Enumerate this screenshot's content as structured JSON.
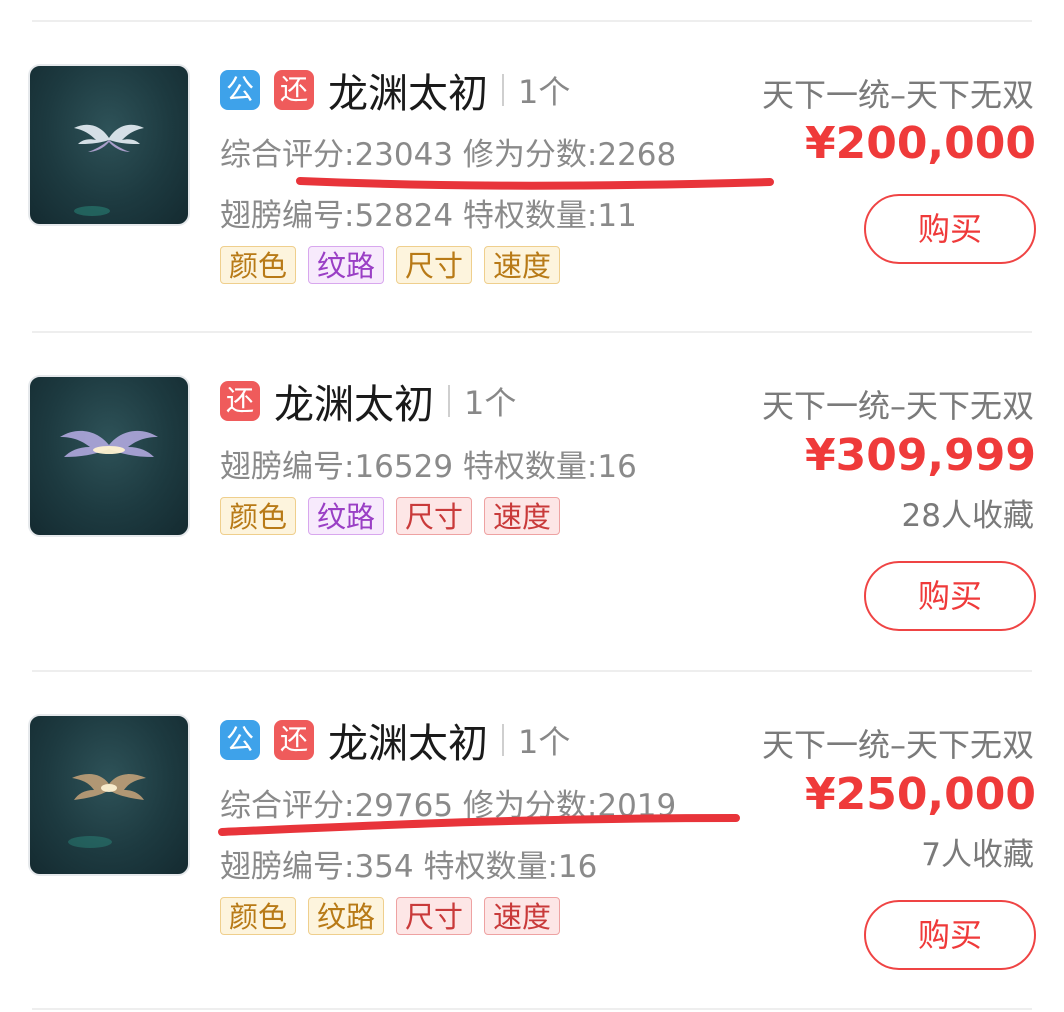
{
  "listings": [
    {
      "badges": [
        "公",
        "还"
      ],
      "name": "龙渊太初",
      "count": "1个",
      "score_line": "综合评分:23043 修为分数:2268",
      "wing_line": "翅膀编号:52824 特权数量:11",
      "tags": [
        "颜色",
        "纹路",
        "尺寸",
        "速度"
      ],
      "server": "天下一统–天下无双",
      "price": "¥200,000",
      "buy_label": "购买"
    },
    {
      "badges": [
        "还"
      ],
      "name": "龙渊太初",
      "count": "1个",
      "wing_line": "翅膀编号:16529 特权数量:16",
      "tags": [
        "颜色",
        "纹路",
        "尺寸",
        "速度"
      ],
      "server": "天下一统–天下无双",
      "price": "¥309,999",
      "favorites": "28人收藏",
      "buy_label": "购买"
    },
    {
      "badges": [
        "公",
        "还"
      ],
      "name": "龙渊太初",
      "count": "1个",
      "score_line": "综合评分:29765 修为分数:2019",
      "wing_line": "翅膀编号:354 特权数量:16",
      "tags": [
        "颜色",
        "纹路",
        "尺寸",
        "速度"
      ],
      "server": "天下一统–天下无双",
      "price": "¥250,000",
      "favorites": "7人收藏",
      "buy_label": "购买"
    }
  ],
  "colors": {
    "price_red": "#ef3a3a",
    "badge_public": "#3ea2ea",
    "badge_return": "#ef5b5b",
    "annotation_underline": "#e8343a"
  }
}
